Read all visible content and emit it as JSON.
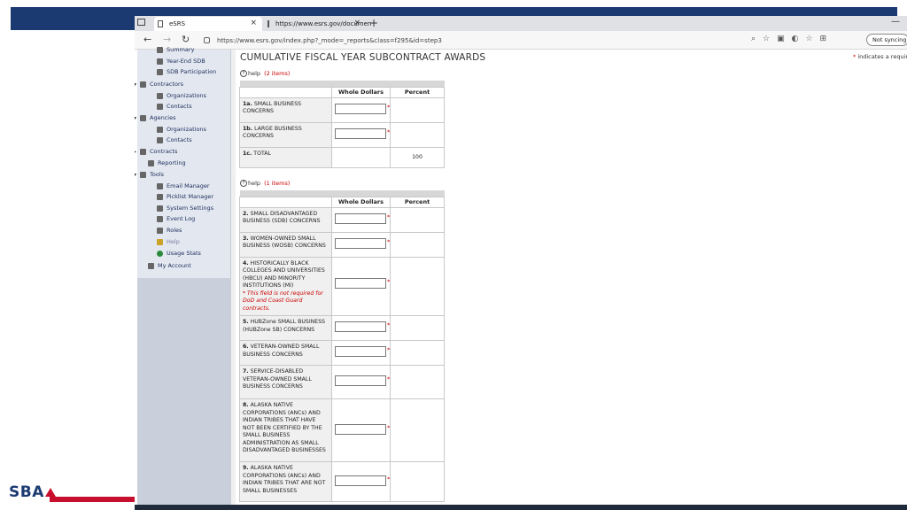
{
  "browser": {
    "tabs": [
      {
        "label": "eSRS"
      },
      {
        "label": "https://www.esrs.gov/documen"
      }
    ],
    "close_glyph": "×",
    "new_tab_glyph": "+",
    "minimize_glyph": "—",
    "url": "https://www.esrs.gov/index.php?_mode=_reports&class=f295&id=step3",
    "sync_label": "Not syncing",
    "icons": [
      "back-icon",
      "forward-icon",
      "refresh-icon",
      "lock-icon",
      "zoom-icon",
      "favorites-icon",
      "extensions-icon"
    ]
  },
  "sidebar": {
    "items": [
      {
        "label": "Summary"
      },
      {
        "label": "Year-End SDB"
      },
      {
        "label": "SDB Participation"
      },
      {
        "label": "Contractors"
      },
      {
        "label": "Organizations"
      },
      {
        "label": "Contacts"
      },
      {
        "label": "Agencies"
      },
      {
        "label": "Organizations"
      },
      {
        "label": "Contacts"
      },
      {
        "label": "Contracts"
      },
      {
        "label": "Reporting"
      },
      {
        "label": "Tools"
      },
      {
        "label": "Email Manager"
      },
      {
        "label": "Picklist Manager"
      },
      {
        "label": "System Settings"
      },
      {
        "label": "Event Log"
      },
      {
        "label": "Roles"
      },
      {
        "label": "Help"
      },
      {
        "label": "Usage Stats"
      },
      {
        "label": "My Account"
      }
    ]
  },
  "page": {
    "title": "CUMULATIVE FISCAL YEAR SUBCONTRACT AWARDS",
    "required_note": "indicates a require",
    "required_mark": "*",
    "help_label": "help",
    "help1_count": "(2 items)",
    "help2_count": "(1 items)"
  },
  "table1": {
    "headers": [
      "Whole Dollars",
      "Percent"
    ],
    "rows": [
      {
        "num": "1a.",
        "label": "SMALL BUSINESS CONCERNS"
      },
      {
        "num": "1b.",
        "label": "LARGE BUSINESS CONCERNS"
      },
      {
        "num": "1c.",
        "label": "TOTAL",
        "percent": "100"
      }
    ]
  },
  "table2": {
    "headers": [
      "Whole Dollars",
      "Percent"
    ],
    "rows": [
      {
        "num": "2.",
        "label": "SMALL DISADVANTAGED BUSINESS (SDB) CONCERNS"
      },
      {
        "num": "3.",
        "label": "WOMEN-OWNED SMALL BUSINESS (WOSB) CONCERNS"
      },
      {
        "num": "4.",
        "label": "HISTORICALLY BLACK COLLEGES AND UNIVERSITIES (HBCU) AND MINORITY INSTITUTIONS (MI)",
        "note": "* This field is not required for DoD and Coast Guard contracts."
      },
      {
        "num": "5.",
        "label": "HUBZone SMALL BUSINESS (HUBZone SB) CONCERNS"
      },
      {
        "num": "6.",
        "label": "VETERAN-OWNED SMALL BUSINESS CONCERNS"
      },
      {
        "num": "7.",
        "label": "SERVICE-DISABLED VETERAN-OWNED SMALL BUSINESS CONCERNS"
      },
      {
        "num": "8.",
        "label": "ALASKA NATIVE CORPORATIONS (ANCs) AND INDIAN TRIBES THAT HAVE NOT BEEN CERTIFIED BY THE SMALL BUSINESS ADMINISTRATION AS SMALL DISADVANTAGED BUSINESSES"
      },
      {
        "num": "9.",
        "label": "ALASKA NATIVE CORPORATIONS (ANCs) AND INDIAN TRIBES THAT ARE NOT SMALL BUSINESSES"
      }
    ]
  },
  "branding": {
    "logo_text": "SBA",
    "colors": {
      "navy": "#1c3a72",
      "red": "#c8102e"
    }
  }
}
